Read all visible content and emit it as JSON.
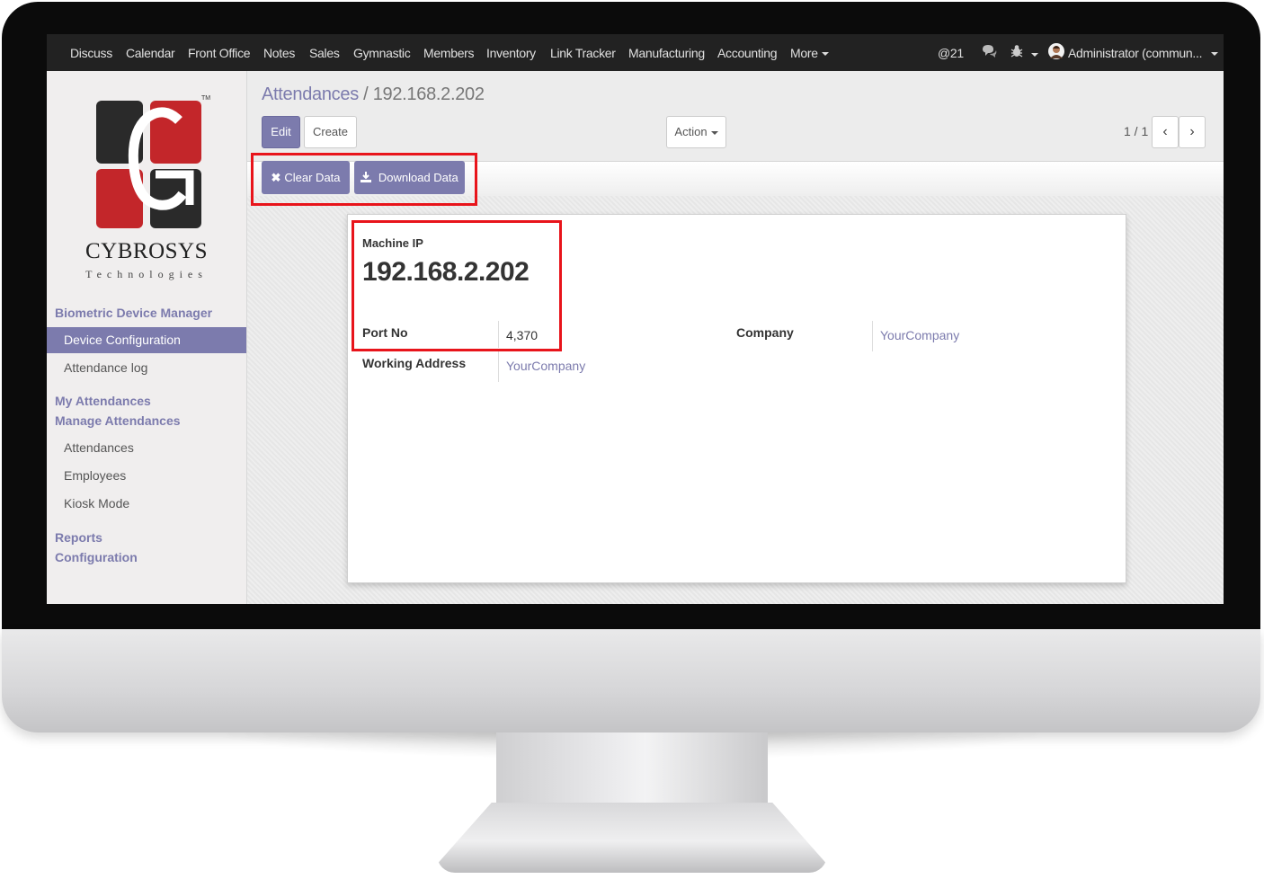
{
  "topbar": {
    "menu": [
      "Discuss",
      "Calendar",
      "Front Office",
      "Notes",
      "Sales",
      "Gymnastic",
      "Members",
      "Inventory",
      "Link Tracker",
      "Manufacturing",
      "Accounting",
      "More"
    ],
    "mentions": "@21",
    "user": "Administrator (commun..."
  },
  "sidebar": {
    "brand": "CYBROSYS",
    "brand_sub": "Technologies",
    "tm": "TM",
    "sections": {
      "biometric": "Biometric Device Manager",
      "device_configuration": "Device Configuration",
      "attendance_log": "Attendance log",
      "my_attendances": "My Attendances",
      "manage_attendances": "Manage Attendances",
      "attendances": "Attendances",
      "employees": "Employees",
      "kiosk_mode": "Kiosk Mode",
      "reports": "Reports",
      "configuration": "Configuration"
    }
  },
  "breadcrumb": {
    "parent": "Attendances",
    "separator": "/",
    "current": "192.168.2.202"
  },
  "buttons": {
    "edit": "Edit",
    "create": "Create",
    "action": "Action",
    "clear_data": "Clear Data",
    "download_data": "Download Data"
  },
  "pager": {
    "text": "1 / 1"
  },
  "form": {
    "machine_ip_label": "Machine IP",
    "machine_ip_value": "192.168.2.202",
    "port_no_label": "Port No",
    "port_no_value": "4,370",
    "company_label": "Company",
    "company_value": "YourCompany",
    "working_address_label": "Working Address",
    "working_address_value": "YourCompany"
  },
  "colors": {
    "accent": "#7c7bad",
    "topbar": "#222222",
    "highlight": "#e8141b"
  }
}
